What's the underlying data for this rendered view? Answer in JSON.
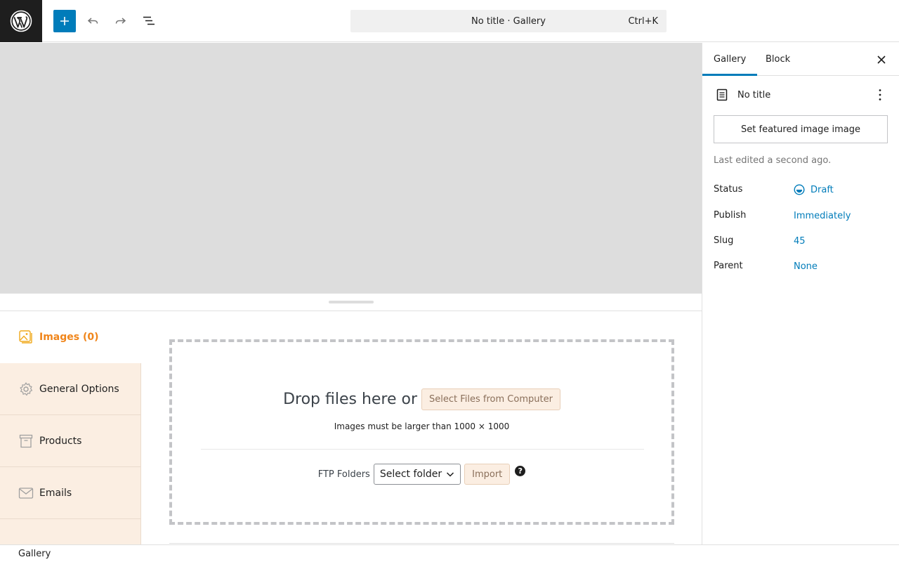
{
  "toolbar": {
    "command_bar_title": "No title · Gallery",
    "command_bar_shortcut": "Ctrl+K"
  },
  "meta_box": {
    "nav": [
      {
        "label": "Images (0)",
        "icon": "images-icon",
        "active": true
      },
      {
        "label": "General Options",
        "icon": "gear-icon",
        "active": false
      },
      {
        "label": "Products",
        "icon": "archive-icon",
        "active": false
      },
      {
        "label": "Emails",
        "icon": "envelope-icon",
        "active": false
      }
    ],
    "dropzone": {
      "drop_text": "Drop files here or",
      "select_files_label": "Select Files from Computer",
      "size_note": "Images must be larger than 1000 × 1000",
      "ftp_label": "FTP Folders",
      "ftp_select_value": "Select folder",
      "import_label": "Import",
      "help_glyph": "?"
    }
  },
  "footer": {
    "breadcrumb": "Gallery"
  },
  "sidebar": {
    "tabs": [
      "Gallery",
      "Block"
    ],
    "active_tab": "Gallery",
    "post_title": "No title",
    "featured_image_label": "Set featured image image",
    "last_edited": "Last edited a second ago.",
    "properties": [
      {
        "label": "Status",
        "value": "Draft"
      },
      {
        "label": "Publish",
        "value": "Immediately"
      },
      {
        "label": "Slug",
        "value": "45"
      },
      {
        "label": "Parent",
        "value": "None"
      }
    ]
  },
  "colors": {
    "accent": "#007cba",
    "active_nav": "#f0851a",
    "nav_bg": "#fbeee2",
    "canvas_bg": "#dddddd"
  }
}
